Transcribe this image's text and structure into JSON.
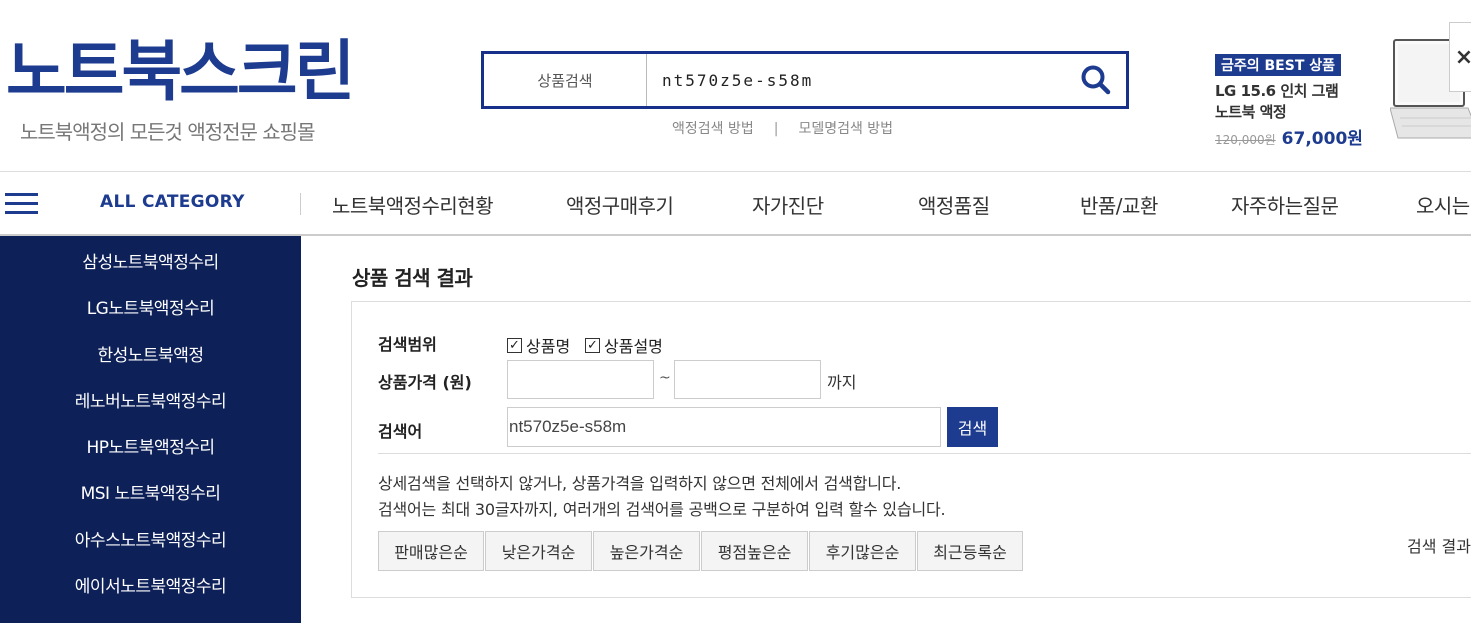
{
  "header": {
    "logo_main": "노트북스크린",
    "logo_sub": "노트북액정의 모든것 액정전문 쇼핑몰",
    "search": {
      "label": "상품검색",
      "value": "nt570z5e-s58m",
      "link1": "액정검색 방법",
      "sep": "|",
      "link2": "모델명검색 방법"
    },
    "best": {
      "badge": "금주의 BEST 상품",
      "line1": "LG 15.6 인치 그램",
      "line2": "노트북 액정",
      "old_price": "120,000원",
      "new_price": "67,000원"
    },
    "close_symbol": "×",
    "colors": {
      "brand": "#1d3b8f",
      "sidebar": "#0d2058"
    }
  },
  "nav": {
    "all_category": "ALL CATEGORY",
    "items": [
      "노트북액정수리현황",
      "액정구매후기",
      "자가진단",
      "액정품질",
      "반품/교환",
      "자주하는질문",
      "오시는"
    ]
  },
  "sidebar": {
    "items": [
      "삼성노트북액정수리",
      "LG노트북액정수리",
      "한성노트북액정",
      "레노버노트북액정수리",
      "HP노트북액정수리",
      "MSI 노트북액정수리",
      "아수스노트북액정수리",
      "에이서노트북액정수리"
    ]
  },
  "main": {
    "title": "상품 검색 결과",
    "scope_label": "검색범위",
    "scope_options": [
      {
        "label": "상품명",
        "checked": true
      },
      {
        "label": "상품설명",
        "checked": true
      }
    ],
    "price_label": "상품가격 (원)",
    "price_tilde": "~",
    "price_until": "까지",
    "keyword_label": "검색어",
    "keyword_value": "nt570z5e-s58m",
    "keyword_button": "검색",
    "desc1": "상세검색을 선택하지 않거나, 상품가격을 입력하지 않으면 전체에서 검색합니다.",
    "desc2": "검색어는 최대 30글자까지, 여러개의 검색어를 공백으로 구분하여 입력 할수 있습니다.",
    "sort_buttons": [
      "판매많은순",
      "낮은가격순",
      "높은가격순",
      "평점높은순",
      "후기많은순",
      "최근등록순"
    ],
    "result_text": "검색 결과"
  }
}
